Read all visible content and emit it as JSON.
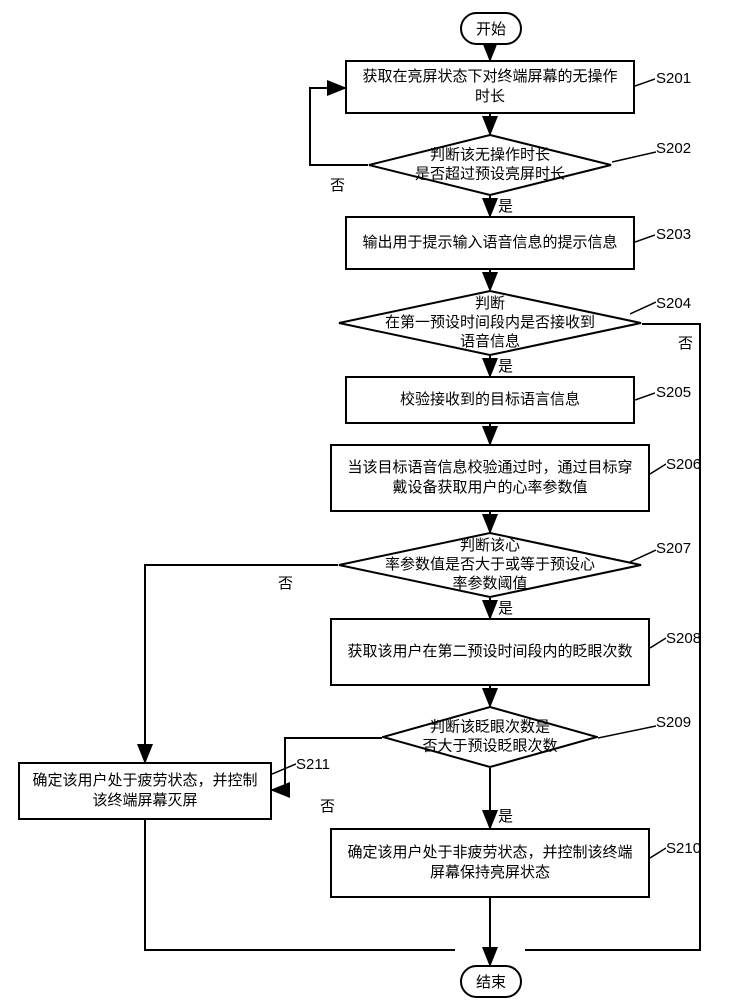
{
  "terminals": {
    "start": "开始",
    "end": "结束"
  },
  "steps": {
    "s201": {
      "label": "S201",
      "text": "获取在亮屏状态下对终端屏幕的无操作时长"
    },
    "s202": {
      "label": "S202",
      "text_l1": "判断该无操作时长",
      "text_l2": "是否超过预设亮屏时长"
    },
    "s203": {
      "label": "S203",
      "text": "输出用于提示输入语音信息的提示信息"
    },
    "s204": {
      "label": "S204",
      "text_l1": "判断",
      "text_l2": "在第一预设时间段内是否接收到",
      "text_l3": "语音信息"
    },
    "s205": {
      "label": "S205",
      "text": "校验接收到的目标语言信息"
    },
    "s206": {
      "label": "S206",
      "text": "当该目标语音信息校验通过时，通过目标穿戴设备获取用户的心率参数值"
    },
    "s207": {
      "label": "S207",
      "text_l1": "判断该心",
      "text_l2": "率参数值是否大于或等于预设心",
      "text_l3": "率参数阈值"
    },
    "s208": {
      "label": "S208",
      "text": "获取该用户在第二预设时间段内的眨眼次数"
    },
    "s209": {
      "label": "S209",
      "text_l1": "判断该眨眼次数是",
      "text_l2": "否大于预设眨眼次数"
    },
    "s210": {
      "label": "S210",
      "text": "确定该用户处于非疲劳状态，并控制该终端屏幕保持亮屏状态"
    },
    "s211": {
      "label": "S211",
      "text": "确定该用户处于疲劳状态，并控制该终端屏幕灭屏"
    }
  },
  "branches": {
    "yes": "是",
    "no": "否"
  }
}
